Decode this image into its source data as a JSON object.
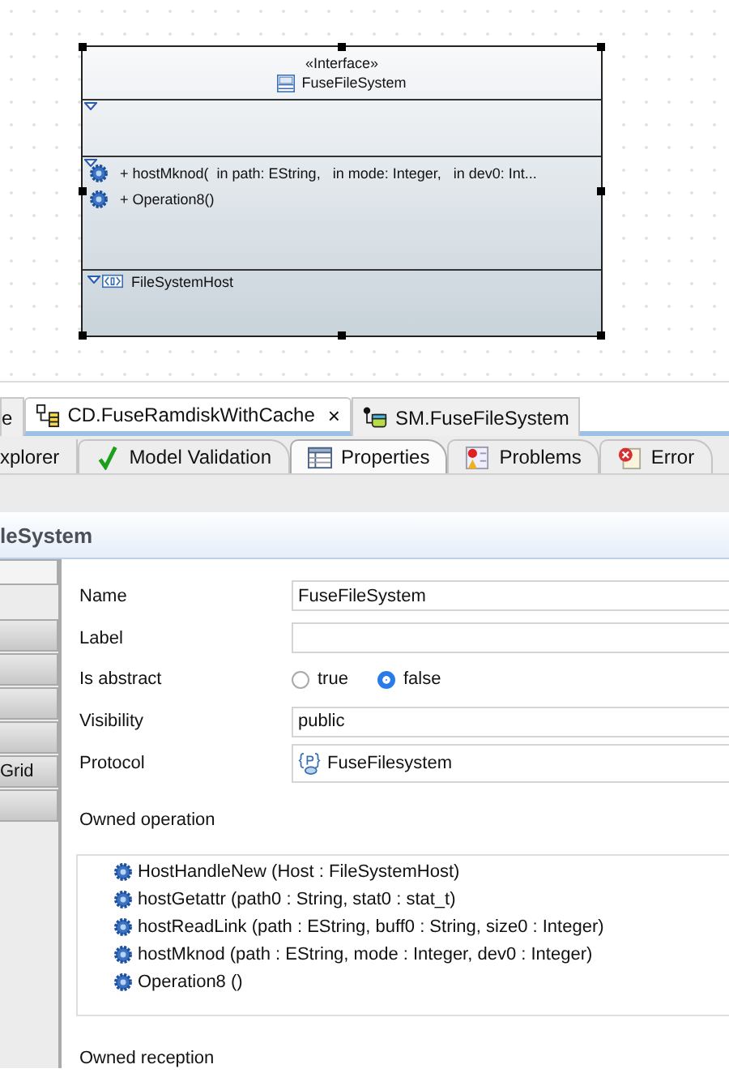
{
  "diagram": {
    "class_box": {
      "stereotype": "«Interface»",
      "name": "FuseFileSystem",
      "selected": true,
      "operations": [
        {
          "text": "+ hostMknod(  in path: EString,   in mode: Integer,   in dev0: Int..."
        },
        {
          "text": "+ Operation8()"
        }
      ],
      "nested": [
        {
          "name": "FileSystemHost"
        }
      ]
    }
  },
  "editor_tabs": [
    {
      "label": "e",
      "selected": false,
      "kind": "plain"
    },
    {
      "label": "CD.FuseRamdiskWithCache",
      "selected": true,
      "kind": "class-diagram",
      "close": "×"
    },
    {
      "label": "SM.FuseFileSystem",
      "selected": false,
      "kind": "state-machine"
    }
  ],
  "view_tabs": [
    {
      "label": "xplorer",
      "selected": false,
      "kind": "plain"
    },
    {
      "label": "Model Validation",
      "selected": false,
      "kind": "check"
    },
    {
      "label": "Properties",
      "selected": true,
      "kind": "table"
    },
    {
      "label": "Problems",
      "selected": false,
      "kind": "problems"
    },
    {
      "label": "Error",
      "selected": false,
      "kind": "error"
    }
  ],
  "properties": {
    "title": "leSystem",
    "sidebar_tabs": [
      {
        "selected": true
      },
      {
        "selected": false
      },
      {
        "selected": false
      },
      {
        "selected": false
      },
      {
        "selected": false
      },
      {
        "label": "Grid",
        "selected": false
      },
      {
        "selected": false
      }
    ],
    "fields": [
      {
        "kind": "text",
        "label": "Name",
        "value": "FuseFileSystem"
      },
      {
        "kind": "text",
        "label": "Label"
      },
      {
        "kind": "radio",
        "label": "Is abstract",
        "options": [
          {
            "label": "true",
            "selected": false
          },
          {
            "label": "false",
            "selected": true
          }
        ]
      },
      {
        "kind": "text",
        "label": "Visibility",
        "value": "public"
      },
      {
        "kind": "ref",
        "label": "Protocol",
        "value": "FuseFilesystem"
      }
    ],
    "owned_operation": {
      "label": "Owned operation",
      "items": [
        {
          "text": "HostHandleNew (Host : FileSystemHost)"
        },
        {
          "text": "hostGetattr (path0 : String, stat0 : stat_t)"
        },
        {
          "text": "hostReadLink (path : EString, buff0 : String, size0 : Integer)"
        },
        {
          "text": "hostMknod (path : EString, mode : Integer, dev0 : Integer)"
        },
        {
          "text": "Operation8 ()"
        }
      ]
    },
    "owned_reception": {
      "label": "Owned reception"
    }
  }
}
